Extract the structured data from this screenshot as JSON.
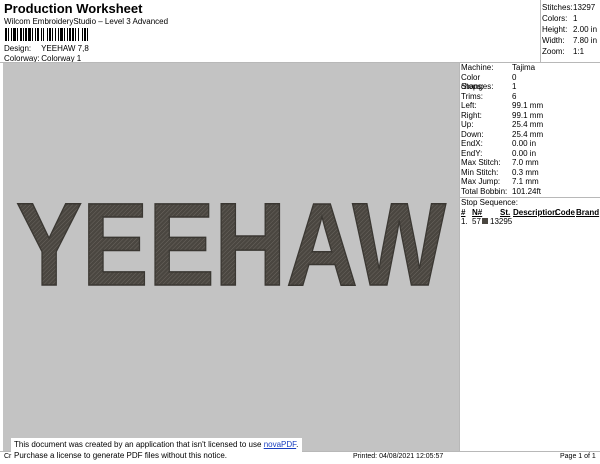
{
  "header": {
    "title": "Production Worksheet",
    "subtitle": "Wilcom EmbroideryStudio – Level 3 Advanced",
    "design_label": "Design:",
    "design_value": "YEEHAW 7,8",
    "colorway_label": "Colorway:",
    "colorway_value": "Colorway 1"
  },
  "stats": [
    {
      "label": "Stitches:",
      "value": "13297"
    },
    {
      "label": "Colors:",
      "value": "1"
    },
    {
      "label": "Height:",
      "value": "2.00 in"
    },
    {
      "label": "Width:",
      "value": "7.80 in"
    },
    {
      "label": "Zoom:",
      "value": "1:1"
    }
  ],
  "design": {
    "text": "YEEHAW",
    "thread_color": "#4a4640",
    "background_color": "#c3c3c3"
  },
  "machine_info": [
    {
      "label": "Machine:",
      "value": "Tajima"
    },
    {
      "label": "Color changes:",
      "value": "0"
    },
    {
      "label": "Stops:",
      "value": "1"
    },
    {
      "label": "Trims:",
      "value": "6"
    },
    {
      "label": "Left:",
      "value": "99.1 mm"
    },
    {
      "label": "Right:",
      "value": "99.1 mm"
    },
    {
      "label": "Up:",
      "value": "25.4 mm"
    },
    {
      "label": "Down:",
      "value": "25.4 mm"
    },
    {
      "label": "EndX:",
      "value": "0.00 in"
    },
    {
      "label": "EndY:",
      "value": "0.00 in"
    },
    {
      "label": "Max Stitch:",
      "value": "7.0 mm"
    },
    {
      "label": "Min Stitch:",
      "value": "0.3 mm"
    },
    {
      "label": "Max Jump:",
      "value": "7.1 mm"
    },
    {
      "label": "Total Bobbin:",
      "value": "101.24ft"
    }
  ],
  "stop_sequence": {
    "title": "Stop Sequence:",
    "columns": [
      "#",
      "N#",
      "St.",
      "Description",
      "Code",
      "Brand"
    ],
    "rows": [
      {
        "index": "1.",
        "needle": "57",
        "stitches": "13295",
        "swatch_color": "#4a4640"
      }
    ]
  },
  "footer": {
    "notice_line1": "This document was created by an application that isn't licensed to use",
    "notice_link": "novaPDF",
    "notice_line1_end": ".",
    "notice_line2": "Purchase a license to generate PDF files without this notice.",
    "left_text": "Cr",
    "printed": "Printed: 04/08/2021 12:05:57",
    "page": "Page 1 of 1"
  }
}
